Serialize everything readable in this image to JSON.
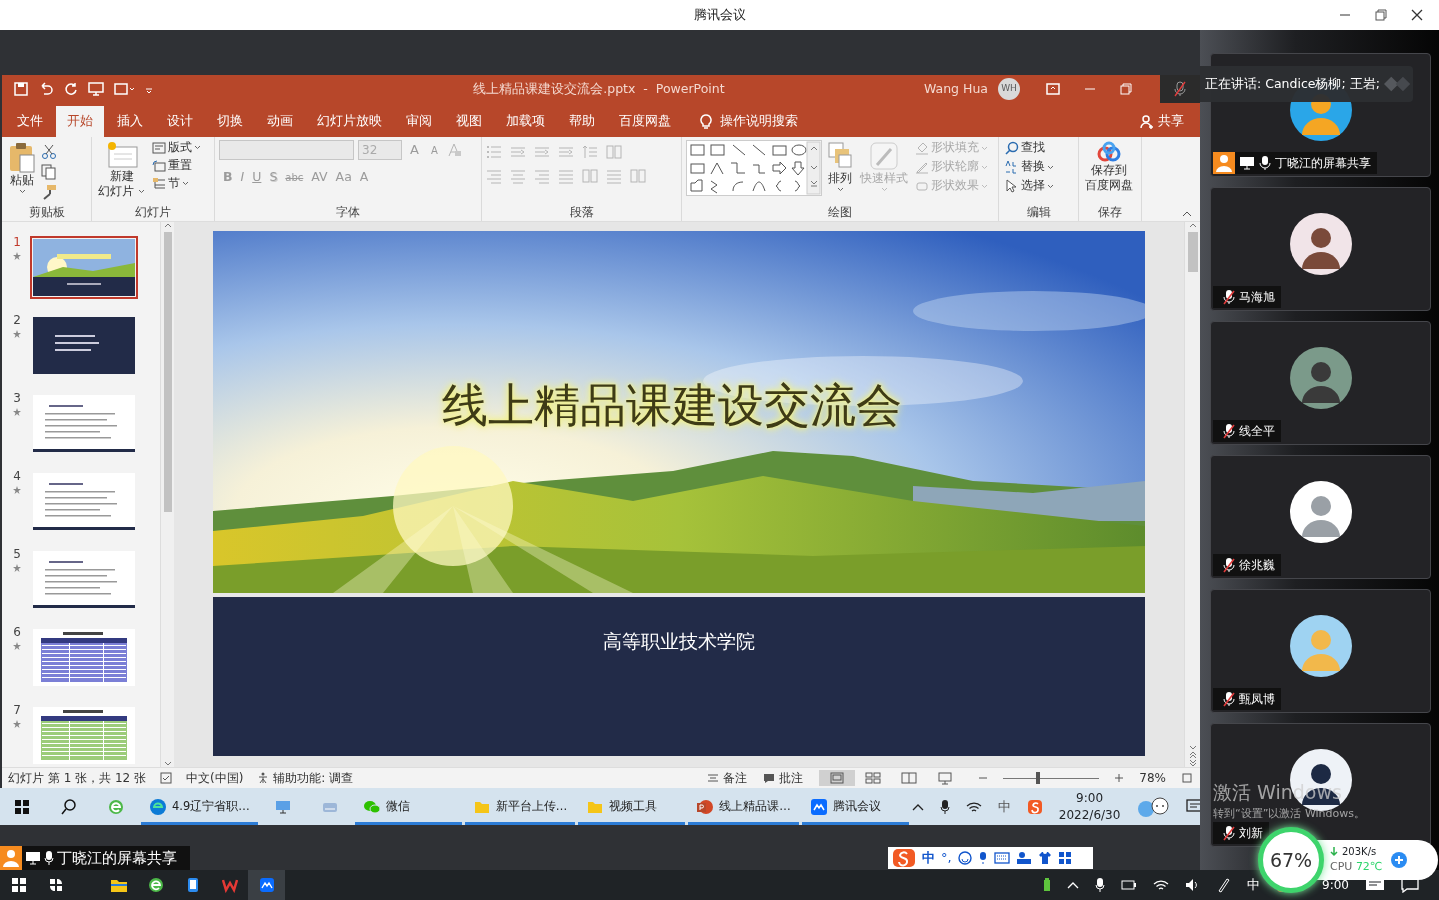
{
  "window": {
    "title": "腾讯会议"
  },
  "ppt": {
    "title": "线上精品课建设交流会.pptx  -  PowerPoint",
    "user_name": "Wang Hua",
    "user_initials": "WH",
    "tabs": [
      {
        "label": "文件",
        "selected": false
      },
      {
        "label": "开始",
        "selected": true
      },
      {
        "label": "插入",
        "selected": false
      },
      {
        "label": "设计",
        "selected": false
      },
      {
        "label": "切换",
        "selected": false
      },
      {
        "label": "动画",
        "selected": false
      },
      {
        "label": "幻灯片放映",
        "selected": false
      },
      {
        "label": "审阅",
        "selected": false
      },
      {
        "label": "视图",
        "selected": false
      },
      {
        "label": "加载项",
        "selected": false
      },
      {
        "label": "帮助",
        "selected": false
      },
      {
        "label": "百度网盘",
        "selected": false
      }
    ],
    "tell_me": "操作说明搜索",
    "share": "共享",
    "clipboard": {
      "label": "剪贴板",
      "paste": "粘贴"
    },
    "slides": {
      "label": "幻灯片",
      "new_slide": [
        "新建",
        "幻灯片"
      ],
      "items": [
        "版式",
        "重置",
        "节"
      ]
    },
    "font": {
      "label": "字体",
      "size": "32",
      "size_buttons": [
        "A",
        "A"
      ],
      "buttons": [
        "B",
        "I",
        "U",
        "S",
        "abc",
        "AV",
        "Aa",
        "A"
      ],
      "disabled": true
    },
    "paragraph": {
      "label": "段落",
      "disabled": true
    },
    "drawing": {
      "label": "绘图",
      "arrange": "排列",
      "quick_styles": {
        "label": "快速样式",
        "disabled": true
      },
      "items": [
        {
          "label": "形状填充",
          "disabled": true
        },
        {
          "label": "形状轮廓",
          "disabled": true
        },
        {
          "label": "形状效果",
          "disabled": true
        }
      ]
    },
    "editing": {
      "label": "编辑",
      "items": [
        "查找",
        "替换",
        "选择"
      ]
    },
    "save": {
      "label": "保存",
      "lines": [
        "保存到",
        "百度网盘"
      ]
    },
    "thumbnails": [
      {
        "number": "1",
        "selected": true,
        "kind": "title"
      },
      {
        "number": "2",
        "selected": false,
        "kind": "dark"
      },
      {
        "number": "3",
        "selected": false,
        "kind": "list"
      },
      {
        "number": "4",
        "selected": false,
        "kind": "list"
      },
      {
        "number": "5",
        "selected": false,
        "kind": "list"
      },
      {
        "number": "6",
        "selected": false,
        "kind": "table-blue"
      },
      {
        "number": "7",
        "selected": false,
        "kind": "table-green"
      }
    ],
    "slide": {
      "title": "线上精品课建设交流会",
      "subtitle": "高等职业技术学院"
    },
    "status": {
      "slide_info": "幻灯片 第 1 张，共 12 张",
      "language": "中文(中国)",
      "accessibility": "辅助功能: 调查",
      "notes": "备注",
      "comments": "批注",
      "views": [
        {
          "selected": true
        },
        {
          "selected": false
        },
        {
          "selected": false
        },
        {
          "selected": false
        }
      ],
      "zoom": {
        "level": 0.36
      },
      "zoom_text": "78%"
    }
  },
  "remote_taskbar": {
    "items": [
      {
        "kind": "start"
      },
      {
        "kind": "search"
      },
      {
        "kind": "ie"
      },
      {
        "kind": "edge",
        "label": "4.9辽宁省职…"
      },
      {
        "kind": "computer"
      },
      {
        "kind": "drive"
      },
      {
        "kind": "wechat",
        "label": "微信"
      },
      {
        "kind": "folder",
        "label": "新平台上传…"
      },
      {
        "kind": "folder",
        "label": "视频工具"
      },
      {
        "kind": "ppt",
        "label": "线上精品课…"
      },
      {
        "kind": "meeting",
        "label": "腾讯会议"
      }
    ],
    "tray": {
      "ime": "中",
      "time": "9:00",
      "date": "2022/6/30"
    }
  },
  "share_banner": "丁晓江的屏幕共享",
  "ime_bar": {
    "mode": "中",
    "punct": "°,"
  },
  "meeting": {
    "speaking": "正在讲话: Candice杨柳; 王岩;",
    "participants": [
      {
        "kind": "sharer",
        "name": "丁晓江的屏幕共享",
        "muted": false
      },
      {
        "kind": "member",
        "name": "马海旭",
        "muted": true
      },
      {
        "kind": "member",
        "name": "线全平",
        "muted": true
      },
      {
        "kind": "member",
        "name": "徐兆巍",
        "muted": true
      },
      {
        "kind": "member",
        "name": "甄凤博",
        "muted": true
      },
      {
        "kind": "member",
        "name": "刘新",
        "muted": true
      }
    ]
  },
  "system_monitor": {
    "percent": "67%",
    "net": "203K/s",
    "cpu_label": "CPU",
    "cpu_temp": "72℃"
  },
  "activation": [
    "激活 Windows",
    "转到“设置”以激活 Windows。"
  ],
  "taskbar": {
    "ime": "中",
    "time": "9:00"
  }
}
